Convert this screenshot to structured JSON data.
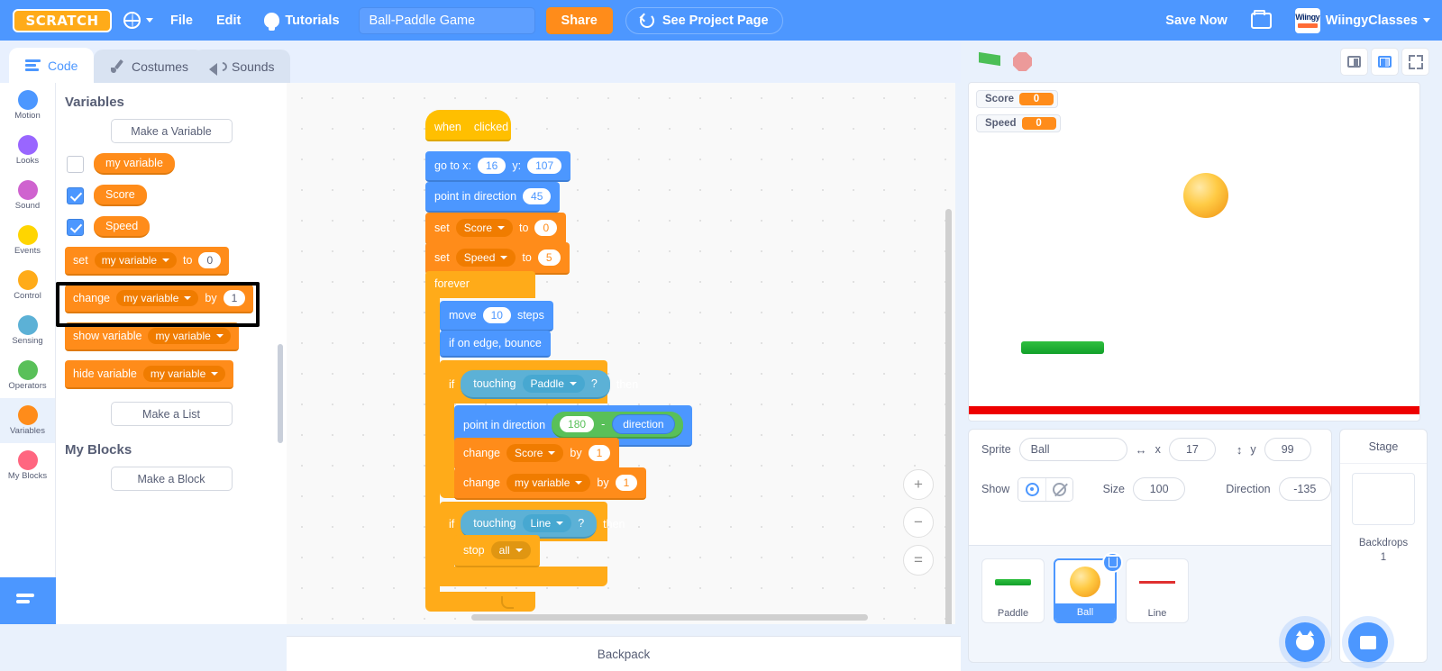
{
  "menubar": {
    "logo": "SCRATCH",
    "globe_icon": "globe-icon",
    "file": "File",
    "edit": "Edit",
    "tutorials": "Tutorials",
    "project_title": "Ball-Paddle Game",
    "share": "Share",
    "see_project_page": "See Project Page",
    "save_now": "Save Now",
    "folder_icon": "folder-icon",
    "username": "WiingyClasses",
    "avatar_text": "Wiingy"
  },
  "tabs": [
    {
      "label": "Code",
      "icon": "code-icon",
      "active": true
    },
    {
      "label": "Costumes",
      "icon": "brush-icon",
      "active": false
    },
    {
      "label": "Sounds",
      "icon": "speaker-icon",
      "active": false
    }
  ],
  "categories": [
    {
      "label": "Motion",
      "color": "#4c97ff"
    },
    {
      "label": "Looks",
      "color": "#9966ff"
    },
    {
      "label": "Sound",
      "color": "#cf63cf"
    },
    {
      "label": "Events",
      "color": "#ffd500"
    },
    {
      "label": "Control",
      "color": "#ffab19"
    },
    {
      "label": "Sensing",
      "color": "#5cb1d6"
    },
    {
      "label": "Operators",
      "color": "#59c059"
    },
    {
      "label": "Variables",
      "color": "#ff8c1a"
    },
    {
      "label": "My Blocks",
      "color": "#ff6680"
    }
  ],
  "palette": {
    "heading": "Variables",
    "make_variable": "Make a Variable",
    "variables": [
      {
        "name": "my variable",
        "checked": false
      },
      {
        "name": "Score",
        "checked": true
      },
      {
        "name": "Speed",
        "checked": true
      }
    ],
    "set_block": {
      "set": "set",
      "var": "my variable",
      "to": "to",
      "value": "0"
    },
    "change_block": {
      "change": "change",
      "var": "my variable",
      "by": "by",
      "value": "1"
    },
    "show_block": {
      "label": "show variable",
      "var": "my variable"
    },
    "hide_block": {
      "label": "hide variable",
      "var": "my variable"
    },
    "make_list": "Make a List",
    "my_blocks_heading": "My Blocks",
    "make_block": "Make a Block"
  },
  "script": {
    "hat": {
      "when": "when",
      "flag": "green-flag-icon",
      "clicked": "clicked"
    },
    "goto": {
      "label": "go to x:",
      "x": "16",
      "ylabel": "y:",
      "y": "107"
    },
    "point1": {
      "label": "point in direction",
      "value": "45"
    },
    "set_score": {
      "set": "set",
      "var": "Score",
      "to": "to",
      "value": "0"
    },
    "set_speed": {
      "set": "set",
      "var": "Speed",
      "to": "to",
      "value": "5"
    },
    "forever": "forever",
    "move": {
      "label": "move",
      "value": "10",
      "suffix": "steps"
    },
    "bounce": "if on edge, bounce",
    "if_paddle": {
      "if": "if",
      "touching": "touching",
      "target": "Paddle",
      "q": "?",
      "then": "then"
    },
    "point2": {
      "label": "point in direction",
      "value": "180",
      "op": "-",
      "reporter": "direction"
    },
    "change_score": {
      "change": "change",
      "var": "Score",
      "by": "by",
      "value": "1"
    },
    "change_myvar": {
      "change": "change",
      "var": "my variable",
      "by": "by",
      "value": "1"
    },
    "if_line": {
      "if": "if",
      "touching": "touching",
      "target": "Line",
      "q": "?",
      "then": "then"
    },
    "stop": {
      "label": "stop",
      "value": "all"
    }
  },
  "code_controls": {
    "zoom_in": "+",
    "zoom_out": "−",
    "zoom_reset": "="
  },
  "stage_controls": {
    "green_flag": "green-flag-icon",
    "stop": "stop-icon",
    "small_stage": "small-stage-icon",
    "large_stage": "large-stage-icon",
    "fullscreen": "fullscreen-icon"
  },
  "stage": {
    "monitors": [
      {
        "name": "Score",
        "value": "0"
      },
      {
        "name": "Speed",
        "value": "0"
      }
    ]
  },
  "sprite_info": {
    "sprite_label": "Sprite",
    "sprite_name": "Ball",
    "x_label": "x",
    "x_value": "17",
    "y_label": "y",
    "y_value": "99",
    "show_label": "Show",
    "size_label": "Size",
    "size_value": "100",
    "direction_label": "Direction",
    "direction_value": "-135"
  },
  "sprites": [
    {
      "name": "Paddle",
      "selected": false,
      "thumb": "paddle"
    },
    {
      "name": "Ball",
      "selected": true,
      "thumb": "ball"
    },
    {
      "name": "Line",
      "selected": false,
      "thumb": "line"
    }
  ],
  "stage_panel": {
    "title": "Stage",
    "backdrops_label": "Backdrops",
    "backdrops_count": "1"
  },
  "add_buttons": {
    "add_sprite": "add-sprite-icon",
    "add_backdrop": "add-backdrop-icon"
  },
  "backpack": {
    "label": "Backpack"
  }
}
